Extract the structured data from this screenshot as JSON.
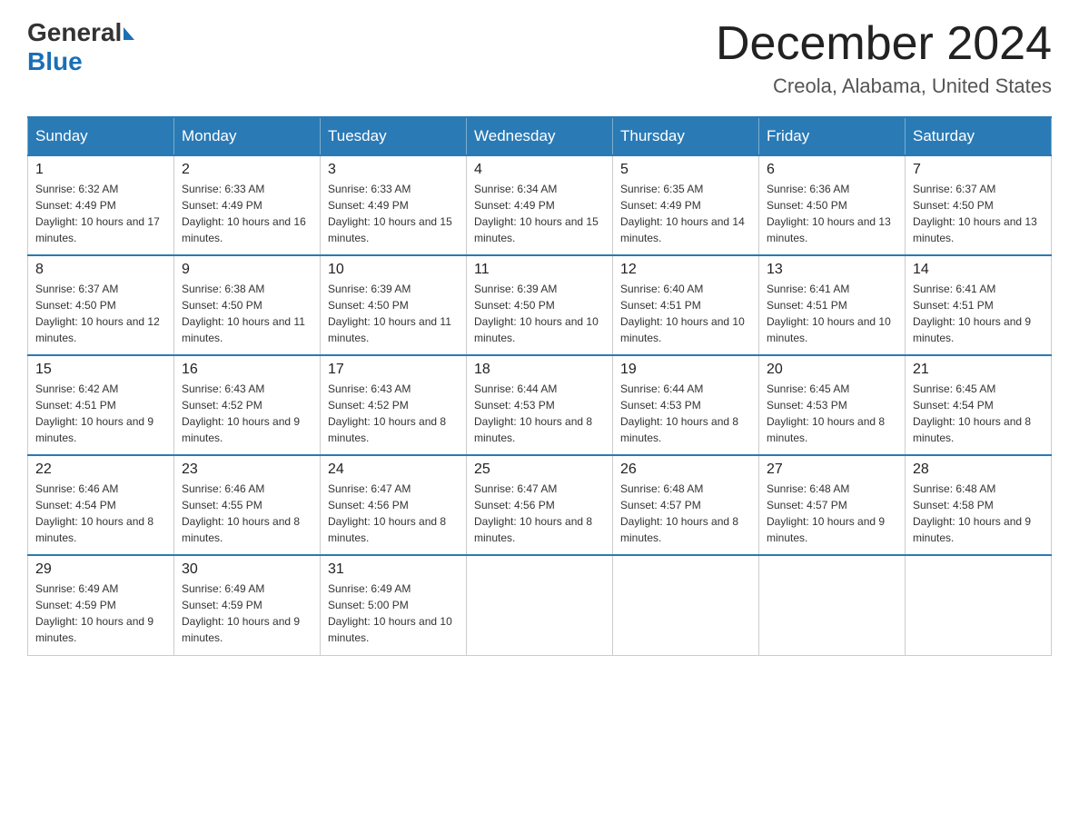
{
  "logo": {
    "general": "General",
    "blue": "Blue"
  },
  "title": "December 2024",
  "location": "Creola, Alabama, United States",
  "days_of_week": [
    "Sunday",
    "Monday",
    "Tuesday",
    "Wednesday",
    "Thursday",
    "Friday",
    "Saturday"
  ],
  "weeks": [
    [
      {
        "day": "1",
        "sunrise": "6:32 AM",
        "sunset": "4:49 PM",
        "daylight": "10 hours and 17 minutes."
      },
      {
        "day": "2",
        "sunrise": "6:33 AM",
        "sunset": "4:49 PM",
        "daylight": "10 hours and 16 minutes."
      },
      {
        "day": "3",
        "sunrise": "6:33 AM",
        "sunset": "4:49 PM",
        "daylight": "10 hours and 15 minutes."
      },
      {
        "day": "4",
        "sunrise": "6:34 AM",
        "sunset": "4:49 PM",
        "daylight": "10 hours and 15 minutes."
      },
      {
        "day": "5",
        "sunrise": "6:35 AM",
        "sunset": "4:49 PM",
        "daylight": "10 hours and 14 minutes."
      },
      {
        "day": "6",
        "sunrise": "6:36 AM",
        "sunset": "4:50 PM",
        "daylight": "10 hours and 13 minutes."
      },
      {
        "day": "7",
        "sunrise": "6:37 AM",
        "sunset": "4:50 PM",
        "daylight": "10 hours and 13 minutes."
      }
    ],
    [
      {
        "day": "8",
        "sunrise": "6:37 AM",
        "sunset": "4:50 PM",
        "daylight": "10 hours and 12 minutes."
      },
      {
        "day": "9",
        "sunrise": "6:38 AM",
        "sunset": "4:50 PM",
        "daylight": "10 hours and 11 minutes."
      },
      {
        "day": "10",
        "sunrise": "6:39 AM",
        "sunset": "4:50 PM",
        "daylight": "10 hours and 11 minutes."
      },
      {
        "day": "11",
        "sunrise": "6:39 AM",
        "sunset": "4:50 PM",
        "daylight": "10 hours and 10 minutes."
      },
      {
        "day": "12",
        "sunrise": "6:40 AM",
        "sunset": "4:51 PM",
        "daylight": "10 hours and 10 minutes."
      },
      {
        "day": "13",
        "sunrise": "6:41 AM",
        "sunset": "4:51 PM",
        "daylight": "10 hours and 10 minutes."
      },
      {
        "day": "14",
        "sunrise": "6:41 AM",
        "sunset": "4:51 PM",
        "daylight": "10 hours and 9 minutes."
      }
    ],
    [
      {
        "day": "15",
        "sunrise": "6:42 AM",
        "sunset": "4:51 PM",
        "daylight": "10 hours and 9 minutes."
      },
      {
        "day": "16",
        "sunrise": "6:43 AM",
        "sunset": "4:52 PM",
        "daylight": "10 hours and 9 minutes."
      },
      {
        "day": "17",
        "sunrise": "6:43 AM",
        "sunset": "4:52 PM",
        "daylight": "10 hours and 8 minutes."
      },
      {
        "day": "18",
        "sunrise": "6:44 AM",
        "sunset": "4:53 PM",
        "daylight": "10 hours and 8 minutes."
      },
      {
        "day": "19",
        "sunrise": "6:44 AM",
        "sunset": "4:53 PM",
        "daylight": "10 hours and 8 minutes."
      },
      {
        "day": "20",
        "sunrise": "6:45 AM",
        "sunset": "4:53 PM",
        "daylight": "10 hours and 8 minutes."
      },
      {
        "day": "21",
        "sunrise": "6:45 AM",
        "sunset": "4:54 PM",
        "daylight": "10 hours and 8 minutes."
      }
    ],
    [
      {
        "day": "22",
        "sunrise": "6:46 AM",
        "sunset": "4:54 PM",
        "daylight": "10 hours and 8 minutes."
      },
      {
        "day": "23",
        "sunrise": "6:46 AM",
        "sunset": "4:55 PM",
        "daylight": "10 hours and 8 minutes."
      },
      {
        "day": "24",
        "sunrise": "6:47 AM",
        "sunset": "4:56 PM",
        "daylight": "10 hours and 8 minutes."
      },
      {
        "day": "25",
        "sunrise": "6:47 AM",
        "sunset": "4:56 PM",
        "daylight": "10 hours and 8 minutes."
      },
      {
        "day": "26",
        "sunrise": "6:48 AM",
        "sunset": "4:57 PM",
        "daylight": "10 hours and 8 minutes."
      },
      {
        "day": "27",
        "sunrise": "6:48 AM",
        "sunset": "4:57 PM",
        "daylight": "10 hours and 9 minutes."
      },
      {
        "day": "28",
        "sunrise": "6:48 AM",
        "sunset": "4:58 PM",
        "daylight": "10 hours and 9 minutes."
      }
    ],
    [
      {
        "day": "29",
        "sunrise": "6:49 AM",
        "sunset": "4:59 PM",
        "daylight": "10 hours and 9 minutes."
      },
      {
        "day": "30",
        "sunrise": "6:49 AM",
        "sunset": "4:59 PM",
        "daylight": "10 hours and 9 minutes."
      },
      {
        "day": "31",
        "sunrise": "6:49 AM",
        "sunset": "5:00 PM",
        "daylight": "10 hours and 10 minutes."
      },
      null,
      null,
      null,
      null
    ]
  ]
}
